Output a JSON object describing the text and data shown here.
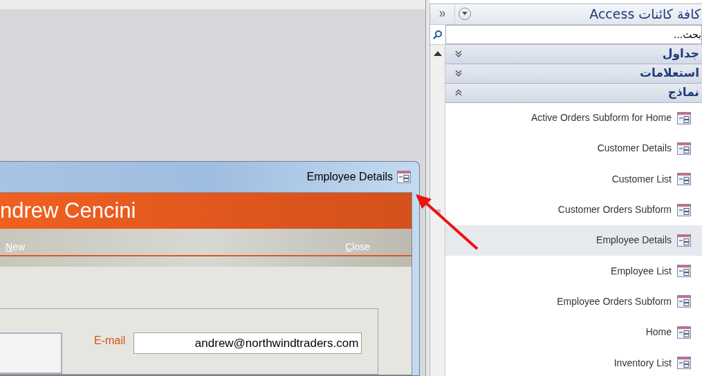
{
  "form_window": {
    "title": "Employee Details",
    "header": "ndrew Cencini",
    "toolbar": [
      {
        "label": "New"
      },
      {
        "label": "Close"
      }
    ],
    "fields": [
      {
        "label": "E-mail",
        "value": "andrew@northwindtraders.com"
      }
    ]
  },
  "nav_pane": {
    "title": "كافة كائنات Access",
    "search": {
      "placeholder": "بحث..."
    },
    "groups": [
      {
        "label": "جداول",
        "expanded": false
      },
      {
        "label": "استعلامات",
        "expanded": false
      },
      {
        "label": "نماذج",
        "expanded": true,
        "items": [
          {
            "label": "Active Orders Subform for Home",
            "selected": false
          },
          {
            "label": "Customer Details",
            "selected": false
          },
          {
            "label": "Customer List",
            "selected": false
          },
          {
            "label": "Customer Orders Subform",
            "selected": false
          },
          {
            "label": "Employee Details",
            "selected": true
          },
          {
            "label": "Employee List",
            "selected": false
          },
          {
            "label": "Employee Orders Subform",
            "selected": false
          },
          {
            "label": "Home",
            "selected": false
          },
          {
            "label": "Inventory List",
            "selected": false
          }
        ]
      }
    ]
  }
}
